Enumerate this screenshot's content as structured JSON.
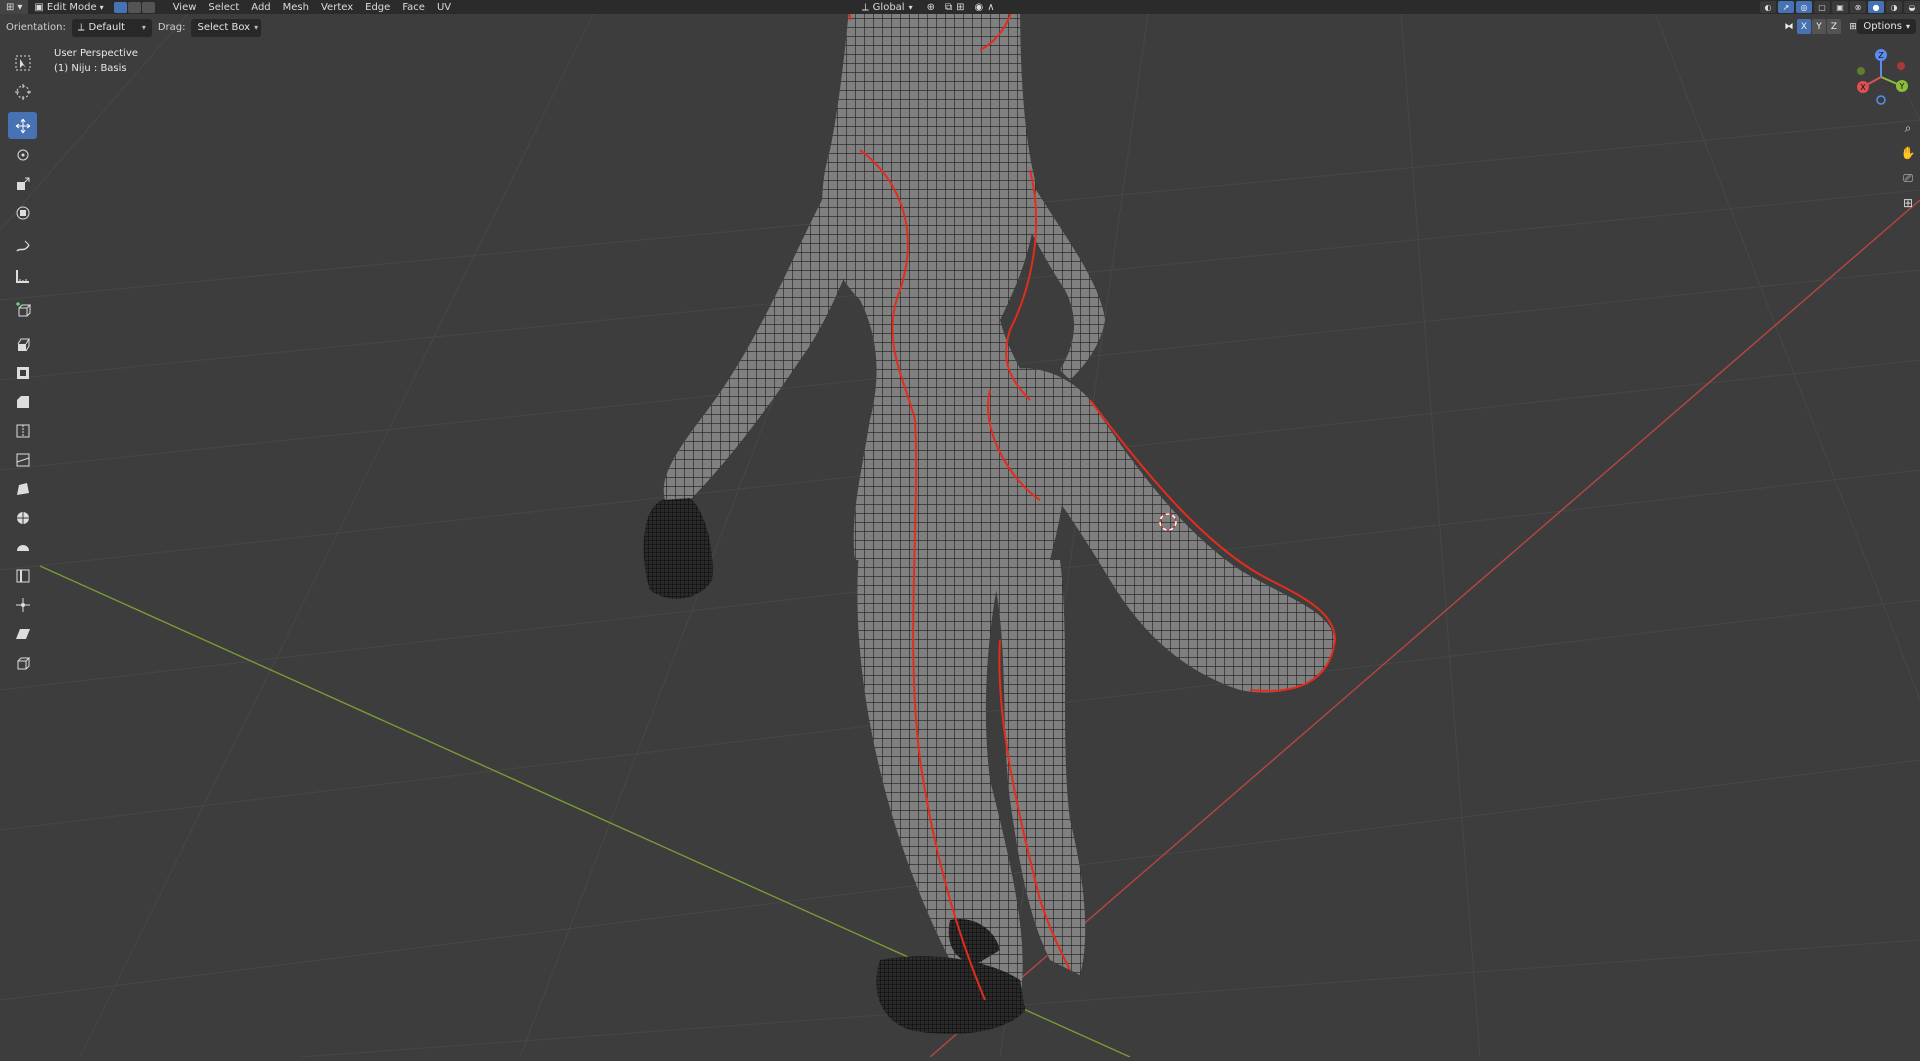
{
  "header": {
    "mode": "Edit Mode",
    "menus": [
      "View",
      "Select",
      "Add",
      "Mesh",
      "Vertex",
      "Edge",
      "Face",
      "UV"
    ],
    "transform_orientation": "Global"
  },
  "toolsettings": {
    "orientation_label": "Orientation:",
    "orientation_value": "Default",
    "drag_label": "Drag:",
    "drag_value": "Select Box",
    "axis_x": "X",
    "axis_y": "Y",
    "axis_z": "Z",
    "options_label": "Options"
  },
  "viewport": {
    "perspective": "User Perspective",
    "object_info": "(1) Niju : Basis"
  },
  "gizmo": {
    "x": "X",
    "y": "Y",
    "z": "Z"
  },
  "tools": [
    "select-box",
    "cursor",
    "move",
    "rotate",
    "scale",
    "transform",
    "annotate",
    "measure",
    "add-cube",
    "extrude-region",
    "inset-faces",
    "bevel",
    "loop-cut",
    "knife",
    "poly-build",
    "spin",
    "smooth",
    "edge-slide",
    "shrink-fatten",
    "shear",
    "rip-region"
  ],
  "colors": {
    "viewport_bg": "#3d3d3d",
    "grid": "#4a4a4a",
    "x_axis": "#c64b4b",
    "y_axis": "#8bab3c",
    "active": "#4772b3",
    "mesh": "#7f7f7f",
    "seam": "#e22c1e"
  }
}
